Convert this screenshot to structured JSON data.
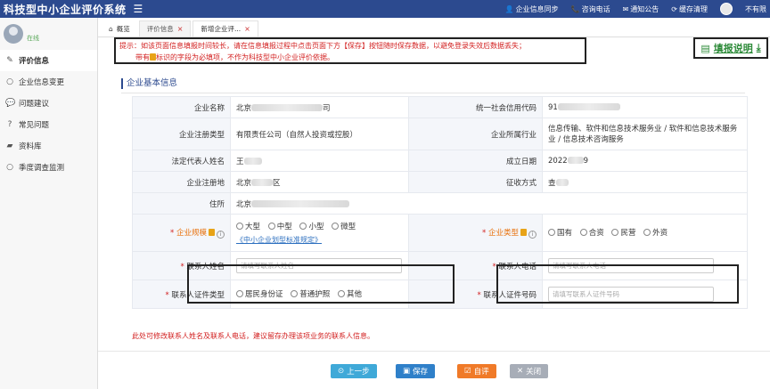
{
  "header": {
    "app_title": "科技型中小企业评价系统",
    "menu_icon": "menu-icon",
    "actions": [
      {
        "icon": "user-icon",
        "label": "企业信息同步"
      },
      {
        "icon": "phone-icon",
        "label": "咨询电话"
      },
      {
        "icon": "mail-icon",
        "label": "通知公告"
      },
      {
        "icon": "refresh-icon",
        "label": "缓存清理"
      }
    ],
    "user_name": "不有限"
  },
  "sidebar": {
    "status": "在线",
    "items": [
      {
        "label": "评价信息",
        "icon": "edit-icon",
        "active": true
      },
      {
        "label": "企业信息变更",
        "icon": "circle-icon"
      },
      {
        "label": "问题建议",
        "icon": "chat-icon"
      },
      {
        "label": "常见问题",
        "icon": "question-icon"
      },
      {
        "label": "资料库",
        "icon": "folder-icon"
      },
      {
        "label": "季度调查监测",
        "icon": "circle-icon"
      }
    ]
  },
  "tabs": [
    {
      "label": "概览",
      "icon": "home-icon"
    },
    {
      "label": "评价信息",
      "closable": true
    },
    {
      "label": "新增企业评...",
      "closable": true,
      "current": true
    }
  ],
  "tip": {
    "line1": "提示：如该页面信息填报时间较长，请在信息填报过程中点击页面下方【保存】按钮随时保存数据，以避免登录失效后数据丢失；",
    "line2_pre": "带有",
    "line2_post": "标识的字段为必填项，不作为科技型中小企业评价依据。"
  },
  "help": {
    "label": "填报说明"
  },
  "section": {
    "title": "企业基本信息"
  },
  "form": {
    "company_name_label": "企业名称",
    "company_name_prefix": "北京",
    "company_name_suffix": "司",
    "credit_code_label": "统一社会信用代码",
    "credit_code_prefix": "91",
    "reg_type_label": "企业注册类型",
    "reg_type_value": "有限责任公司（自然人投资或控股）",
    "industry_label": "企业所属行业",
    "industry_value": "信息传输、软件和信息技术服务业 / 软件和信息技术服务业 / 信息技术咨询服务",
    "legal_rep_label": "法定代表人姓名",
    "legal_rep_prefix": "王",
    "established_label": "成立日期",
    "established_prefix": "2022",
    "established_suffix": "9",
    "reg_place_label": "企业注册地",
    "reg_place_prefix": "北京",
    "reg_place_suffix": "区",
    "collection_label": "征收方式",
    "collection_prefix": "查",
    "residence_label": "住所",
    "residence_prefix": "北京",
    "scale_label": "企业规模",
    "scale_options": [
      "大型",
      "中型",
      "小型",
      "微型"
    ],
    "scale_link": "《中小企业划型标准规定》",
    "type_label": "企业类型",
    "type_options": [
      "国有",
      "合资",
      "民营",
      "外资"
    ],
    "contact_name_label": "联系人姓名",
    "contact_name_placeholder": "请填写联系人姓名",
    "contact_phone_label": "联系人电话",
    "contact_phone_placeholder": "请填写联系人电话",
    "id_type_label": "联系人证件类型",
    "id_type_options": [
      "居民身份证",
      "普通护照",
      "其他"
    ],
    "id_number_label": "联系人证件号码",
    "id_number_placeholder": "请填写联系人证件号码",
    "required_mark": "*"
  },
  "note": "此处可修改联系人姓名及联系人电话，建议留存办理该项业务的联系人信息。",
  "buttons": {
    "prev": "上一步",
    "save": "保存",
    "self_eval": "自评",
    "close": "关闭"
  }
}
